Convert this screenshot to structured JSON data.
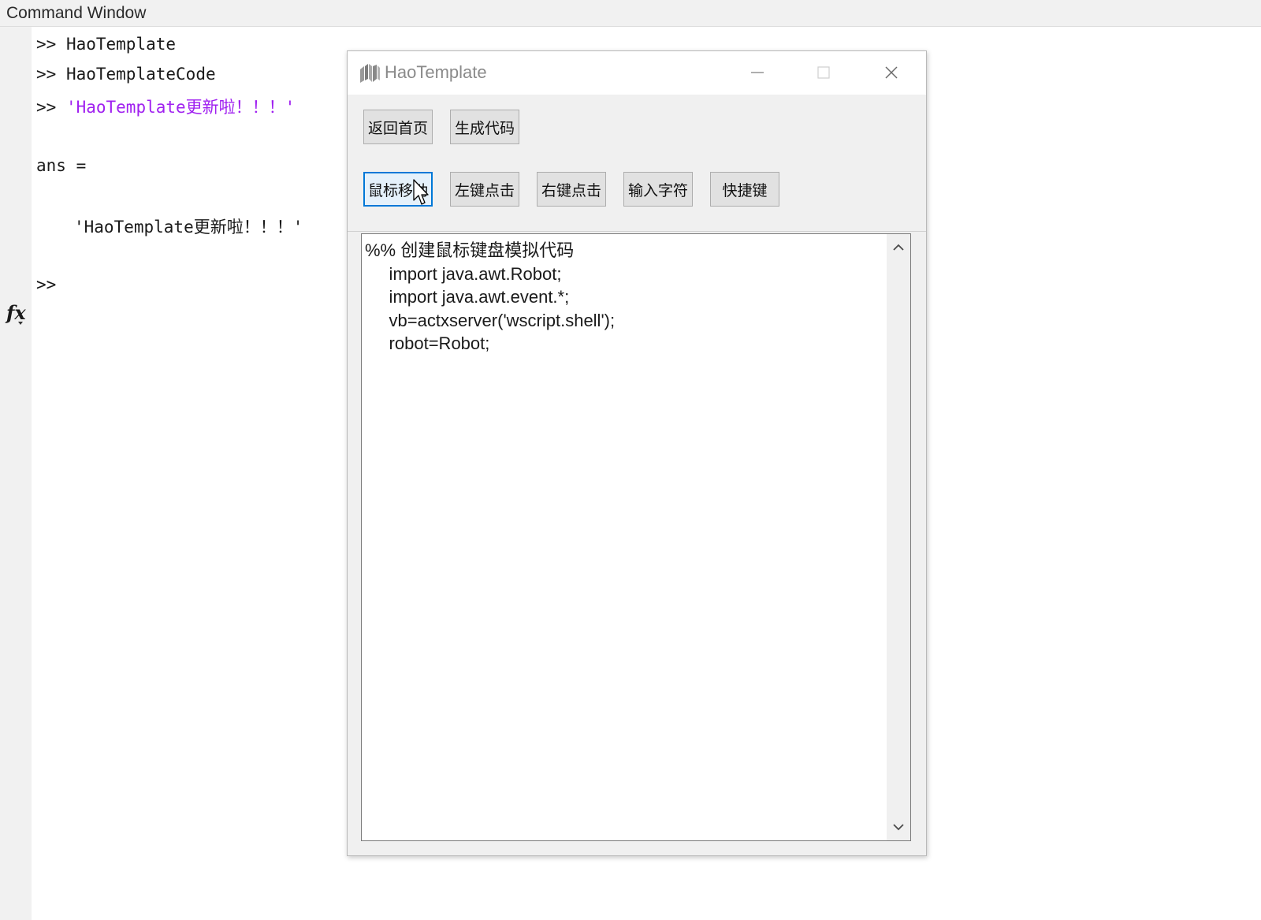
{
  "command_window": {
    "title": "Command Window",
    "lines": [
      {
        "prompt": ">>",
        "text": "HaoTemplate"
      },
      {
        "prompt": ">>",
        "text": "HaoTemplateCode"
      },
      {
        "prompt": ">>",
        "text": "'HaoTemplate更新啦！！！'"
      }
    ],
    "ans_label": "ans =",
    "ans_value": "'HaoTemplate更新啦！！！'",
    "current_prompt": ">>",
    "fx_icon": "fx"
  },
  "dialog": {
    "title": "HaoTemplate",
    "window_controls": [
      "minimize-icon",
      "maximize-icon",
      "close-icon"
    ],
    "row1_buttons": [
      "返回首页",
      "生成代码"
    ],
    "row2_buttons": [
      "鼠标移动",
      "左键点击",
      "右键点击",
      "输入字符",
      "快捷键"
    ],
    "focused_button": "鼠标移动",
    "code_lines": [
      "%% 创建鼠标键盘模拟代码",
      "     import java.awt.Robot;",
      "     import java.awt.event.*;",
      "     vb=actxserver('wscript.shell');",
      "     robot=Robot;"
    ]
  },
  "colors": {
    "string_literal": "#a020f0",
    "focus_border": "#0078d7",
    "button_face": "#e1e1e1",
    "dialog_bg": "#f0f0f0"
  }
}
